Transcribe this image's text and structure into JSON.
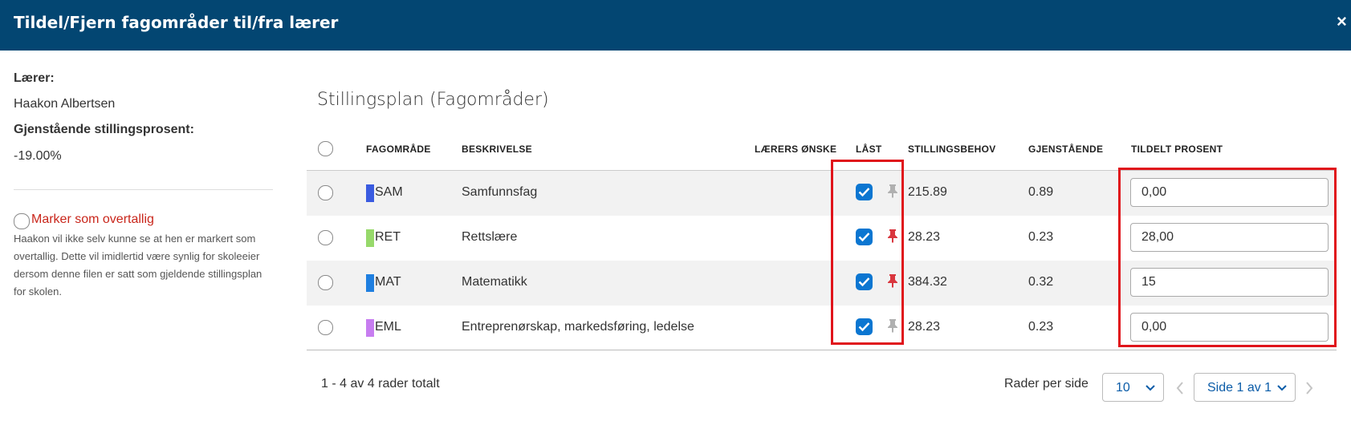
{
  "dialog": {
    "title": "Tildel/Fjern fagområder til/fra lærer",
    "close_label": "×"
  },
  "teacher": {
    "label": "Lærer:",
    "name": "Haakon Albertsen",
    "remaining_label": "Gjenstående stillingsprosent:",
    "remaining_value": "-19.00%"
  },
  "overtallig": {
    "label": "Marker som overtallig",
    "checked": false,
    "note": "Haakon vil ikke selv kunne se at hen er markert som overtallig. Dette vil imidlertid være synlig for skoleeier dersom denne filen er satt som gjeldende stillingsplan for skolen."
  },
  "plan": {
    "title": "Stillingsplan (Fagområder)",
    "columns": [
      "FAGOMRÅDE",
      "BESKRIVELSE",
      "LÆRERS ØNSKE",
      "LÅST",
      "STILLINGSBEHOV",
      "GJENSTÅENDE",
      "TILDELT PROSENT"
    ],
    "rows": [
      {
        "code": "SAM",
        "color": "#3a5be0",
        "description": "Samfunnsfag",
        "locked": true,
        "pinned": false,
        "need": "215.89",
        "remaining": "0.89",
        "assigned": "0,00"
      },
      {
        "code": "RET",
        "color": "#97d96b",
        "description": "Rettslære",
        "locked": true,
        "pinned": true,
        "need": "28.23",
        "remaining": "0.23",
        "assigned": "28,00"
      },
      {
        "code": "MAT",
        "color": "#1f7fe0",
        "description": "Matematikk",
        "locked": true,
        "pinned": true,
        "need": "384.32",
        "remaining": "0.32",
        "assigned": "15"
      },
      {
        "code": "EML",
        "color": "#c77df0",
        "description": "Entreprenørskap, markedsføring, ledelse",
        "locked": true,
        "pinned": false,
        "need": "28.23",
        "remaining": "0.23",
        "assigned": "0,00"
      }
    ]
  },
  "footer": {
    "count_text": "1 - 4 av 4 rader totalt",
    "rows_per_page_label": "Rader per side",
    "rows_per_page_value": "10",
    "page_value": "Side 1 av 1"
  },
  "colors": {
    "header": "#034672",
    "checkbox": "#0b76d1",
    "highlight": "#e0141b",
    "pin_active": "#d9363e",
    "pin_inactive": "#b0b0b0"
  }
}
